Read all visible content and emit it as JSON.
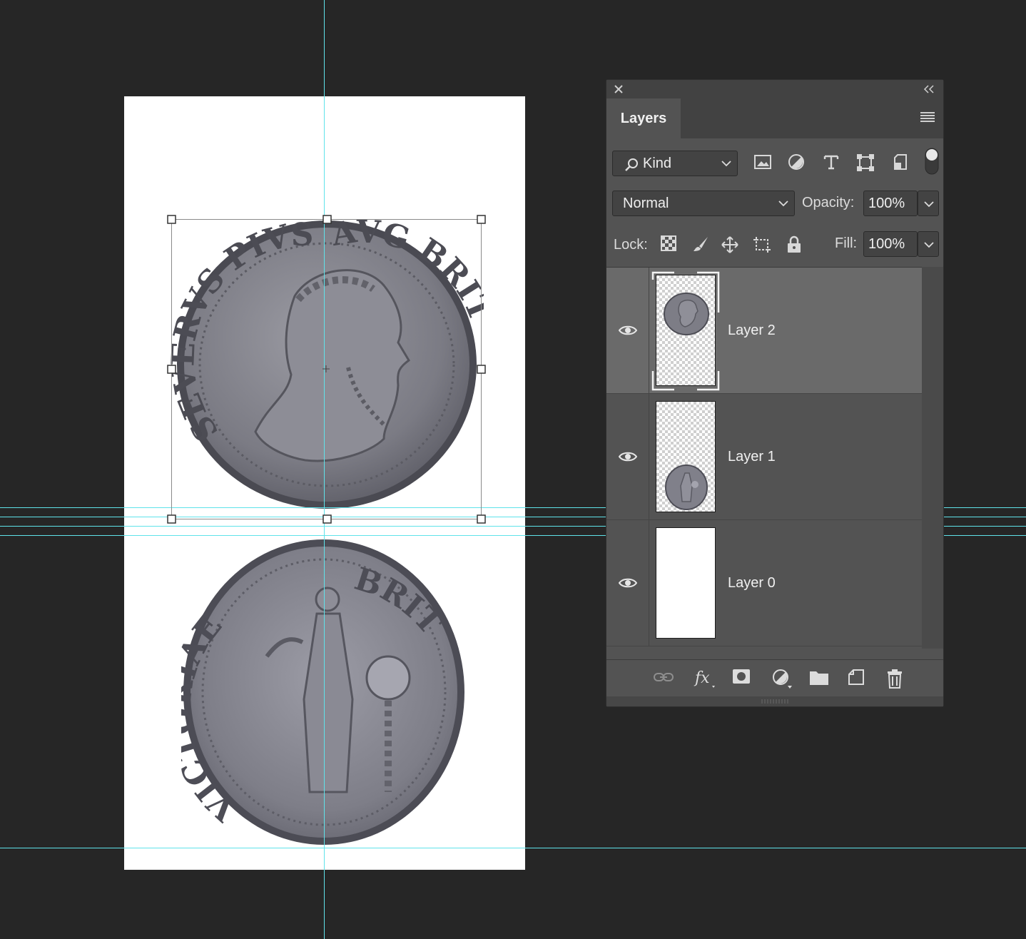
{
  "document": {
    "coin_upper_legend_left": "SEVERVS PIVS",
    "coin_upper_legend_right": "AVG BRIT",
    "coin_lower_legend_left": "VICTORIAE",
    "coin_lower_legend_right": "BRIT"
  },
  "panel": {
    "tab_label": "Layers",
    "filter_kind": "Kind",
    "blend_mode": "Normal",
    "opacity_label": "Opacity:",
    "opacity_value": "100%",
    "lock_label": "Lock:",
    "fill_label": "Fill:",
    "fill_value": "100%"
  },
  "layers": [
    {
      "name": "Layer 2",
      "selected": true,
      "visible": true
    },
    {
      "name": "Layer 1",
      "selected": false,
      "visible": true
    },
    {
      "name": "Layer 0",
      "selected": false,
      "visible": true
    }
  ],
  "colors": {
    "guide": "#5fe3ea",
    "workspace": "#262626",
    "panel": "#535353",
    "selected_row": "#6a6a6a"
  }
}
